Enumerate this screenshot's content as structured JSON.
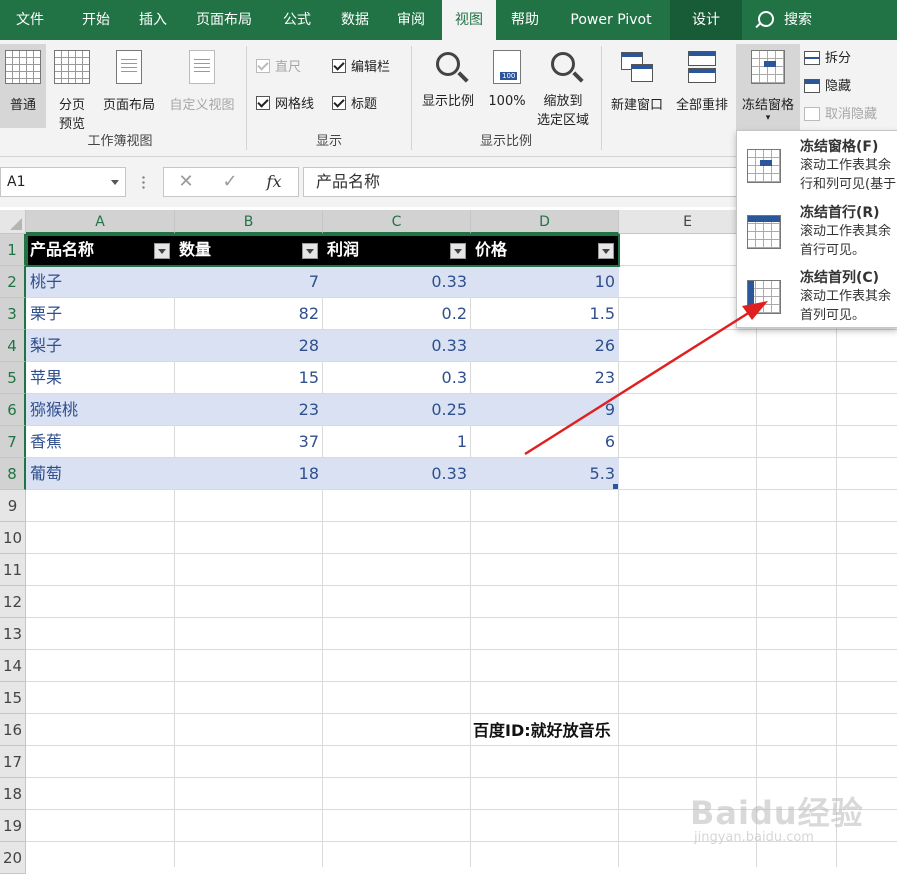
{
  "menu": {
    "tabs": [
      "文件",
      "开始",
      "插入",
      "页面布局",
      "公式",
      "数据",
      "审阅",
      "视图",
      "帮助",
      "Power Pivot",
      "设计"
    ],
    "active": "视图",
    "search": "搜索"
  },
  "ribbon": {
    "workbook_views": {
      "label": "工作簿视图",
      "normal": "普通",
      "page_break_1": "分页",
      "page_break_2": "预览",
      "page_layout": "页面布局",
      "custom": "自定义视图"
    },
    "show": {
      "label": "显示",
      "ruler": "直尺",
      "formula_bar": "编辑栏",
      "gridlines": "网格线",
      "headings": "标题"
    },
    "zoom": {
      "label": "显示比例",
      "zoom": "显示比例",
      "zoom100": "100%",
      "zoom100_badge": "100",
      "zoom_sel_1": "缩放到",
      "zoom_sel_2": "选定区域"
    },
    "window": {
      "new_window": "新建窗口",
      "arrange_all": "全部重排",
      "freeze_panes": "冻结窗格",
      "split": "拆分",
      "hide": "隐藏",
      "unhide": "取消隐藏"
    }
  },
  "formula_bar": {
    "name_box": "A1",
    "fx": "fx",
    "cancel": "✕",
    "enter": "✓",
    "value": "产品名称"
  },
  "columns": [
    "A",
    "B",
    "C",
    "D",
    "E"
  ],
  "rows": [
    "1",
    "2",
    "3",
    "4",
    "5",
    "6",
    "7",
    "8",
    "9",
    "10",
    "11",
    "12",
    "13",
    "14",
    "15",
    "16",
    "17",
    "18",
    "19",
    "20"
  ],
  "table": {
    "headers": [
      "产品名称",
      "数量",
      "利润",
      "价格"
    ],
    "rows": [
      [
        "桃子",
        "7",
        "0.33",
        "10"
      ],
      [
        "栗子",
        "82",
        "0.2",
        "1.5"
      ],
      [
        "梨子",
        "28",
        "0.33",
        "26"
      ],
      [
        "苹果",
        "15",
        "0.3",
        "23"
      ],
      [
        "猕猴桃",
        "23",
        "0.25",
        "9"
      ],
      [
        "香蕉",
        "37",
        "1",
        "6"
      ],
      [
        "葡萄",
        "18",
        "0.33",
        "5.3"
      ]
    ]
  },
  "watermark_cell": "百度ID:就好放音乐",
  "freeze_menu": {
    "items": [
      {
        "title": "冻结窗格(F)",
        "desc1": "滚动工作表其余",
        "desc2": "行和列可见(基于"
      },
      {
        "title": "冻结首行(R)",
        "desc1": "滚动工作表其余",
        "desc2": "首行可见。"
      },
      {
        "title": "冻结首列(C)",
        "desc1": "滚动工作表其余",
        "desc2": "首列可见。"
      }
    ]
  },
  "baidu_logo": {
    "text": "Baidu经验",
    "url": "jingyan.baidu.com"
  },
  "colors": {
    "accent": "#217346",
    "header_fill": "#000000",
    "band_fill": "#d9e1f2",
    "arrow": "#e02020"
  }
}
